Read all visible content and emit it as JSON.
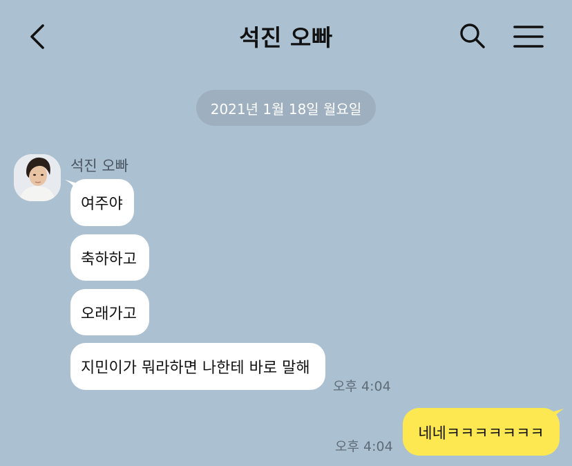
{
  "header": {
    "title": "석진 오빠",
    "back_icon": "chevron-left-icon",
    "search_icon": "search-icon",
    "menu_icon": "hamburger-menu-icon"
  },
  "chat": {
    "date": "2021년 1월 18일 월요일",
    "sender_name": "석진 오빠",
    "received": [
      {
        "text": "여주야"
      },
      {
        "text": "축하하고"
      },
      {
        "text": "오래가고"
      },
      {
        "text": "지민이가 뭐라하면 나한테 바로 말해"
      }
    ],
    "received_time": "오후 4:04",
    "sent": [
      {
        "text": "네네ㅋㅋㅋㅋㅋㅋㅋ"
      }
    ],
    "sent_time": "오후 4:04"
  },
  "colors": {
    "background": "#abc1d1",
    "date_pill": "#9eb0bf",
    "received_bubble": "#ffffff",
    "sent_bubble": "#fee851"
  }
}
